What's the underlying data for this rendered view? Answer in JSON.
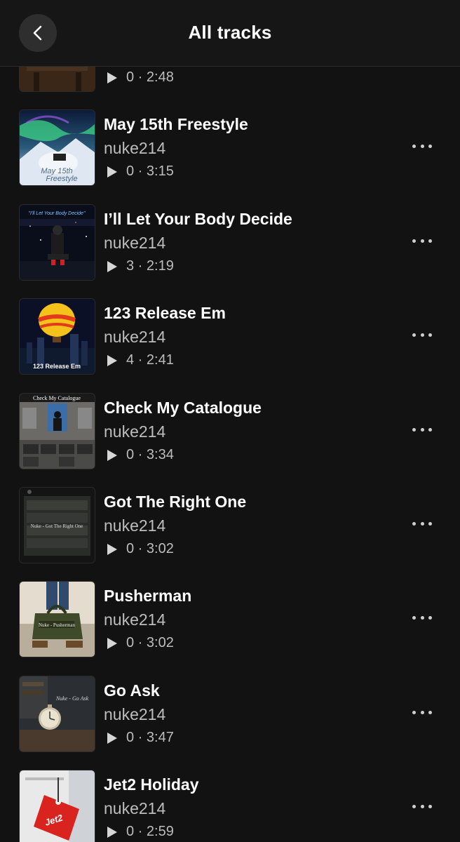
{
  "header": {
    "title": "All tracks",
    "back_icon": "chevron-left-icon"
  },
  "tracks": [
    {
      "title": "",
      "artist": "",
      "plays": "0",
      "duration": "2:48",
      "art_label": ""
    },
    {
      "title": "May 15th Freestyle",
      "artist": "nuke214",
      "plays": "0",
      "duration": "3:15",
      "art_label": "May 15th Freestyle"
    },
    {
      "title": "I’ll Let Your Body Decide",
      "artist": "nuke214",
      "plays": "3",
      "duration": "2:19",
      "art_label": "I'll Let Your Body Decide"
    },
    {
      "title": "123 Release Em",
      "artist": "nuke214",
      "plays": "4",
      "duration": "2:41",
      "art_label": "123 Release Em"
    },
    {
      "title": "Check My Catalogue",
      "artist": "nuke214",
      "plays": "0",
      "duration": "3:34",
      "art_label": "Check My Catalogue"
    },
    {
      "title": "Got The Right One",
      "artist": "nuke214",
      "plays": "0",
      "duration": "3:02",
      "art_label": "Nuke - Got The Right One"
    },
    {
      "title": "Pusherman",
      "artist": "nuke214",
      "plays": "0",
      "duration": "3:02",
      "art_label": "Nuke - Pusherman"
    },
    {
      "title": "Go Ask",
      "artist": "nuke214",
      "plays": "0",
      "duration": "3:47",
      "art_label": "Nuke - Go Ask"
    },
    {
      "title": "Jet2 Holiday",
      "artist": "nuke214",
      "plays": "0",
      "duration": "2:59",
      "art_label": "Jet2"
    }
  ],
  "colors": {
    "background": "#121212",
    "header": "#161616",
    "text_primary": "#ffffff",
    "text_secondary": "#bdbdbd"
  }
}
